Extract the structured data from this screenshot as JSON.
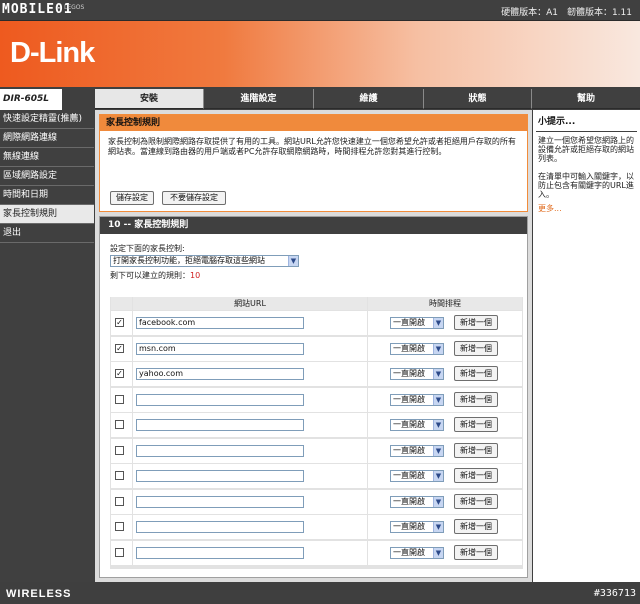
{
  "watermark": {
    "site": "MOBILE01",
    "sub": "LEGOS",
    "image_no": "#336713"
  },
  "versions": "硬體版本：A1　韌體版本：1.11",
  "brand": {
    "logo": "D-Link",
    "model": "DIR-605L",
    "footer": "WIRELESS"
  },
  "tabs": [
    {
      "label": "安裝",
      "active": true
    },
    {
      "label": "進階設定",
      "active": false
    },
    {
      "label": "維護",
      "active": false
    },
    {
      "label": "狀態",
      "active": false
    },
    {
      "label": "幫助",
      "active": false
    }
  ],
  "sidebar": [
    {
      "label": "快速設定精靈(推薦)",
      "active": false
    },
    {
      "label": "網際網路連線",
      "active": false
    },
    {
      "label": "無線連線",
      "active": false
    },
    {
      "label": "區域網路設定",
      "active": false
    },
    {
      "label": "時間和日期",
      "active": false
    },
    {
      "label": "家長控制規則",
      "active": true
    },
    {
      "label": "退出",
      "active": false
    }
  ],
  "intro": {
    "title": "家長控制規則",
    "text": "家長控制為限制網際網路存取提供了有用的工具。網站URL允許您快速建立一個您希望允許或者拒絕用戶存取的所有網站表。當連線到路由器的用戶端或者PC允許存取網際網路時，時間排程允許您對其進行控制。",
    "save_label": "儲存設定",
    "nosave_label": "不要儲存設定"
  },
  "rules": {
    "header": "10 -- 家長控制規則",
    "config_label": "設定下面的家長控制:",
    "mode_value": "打開家長控制功能，拒絕電腦存取這些網站",
    "remaining_label": "剩下可以建立的規則：",
    "remaining_value": "10",
    "col_url": "網站URL",
    "col_schedule": "時間排程",
    "schedule_value": "一直開啟",
    "add_label": "新增一個",
    "rows": [
      {
        "checked": true,
        "url": "facebook.com"
      },
      {
        "checked": true,
        "url": "msn.com"
      },
      {
        "checked": true,
        "url": "yahoo.com"
      },
      {
        "checked": false,
        "url": ""
      },
      {
        "checked": false,
        "url": ""
      },
      {
        "checked": false,
        "url": ""
      },
      {
        "checked": false,
        "url": ""
      },
      {
        "checked": false,
        "url": ""
      },
      {
        "checked": false,
        "url": ""
      },
      {
        "checked": false,
        "url": ""
      }
    ]
  },
  "help": {
    "title": "小提示...",
    "p1": "建立一個您希望您網路上的設備允許或拒絕存取的網站列表。",
    "p2": "在清單中可輸入關鍵字，以防止包含有關鍵字的URL進入。",
    "more": "更多..."
  },
  "colors": {
    "orange": "#f08a3c",
    "dark": "#404040",
    "accent_text": "#e06a1c"
  }
}
